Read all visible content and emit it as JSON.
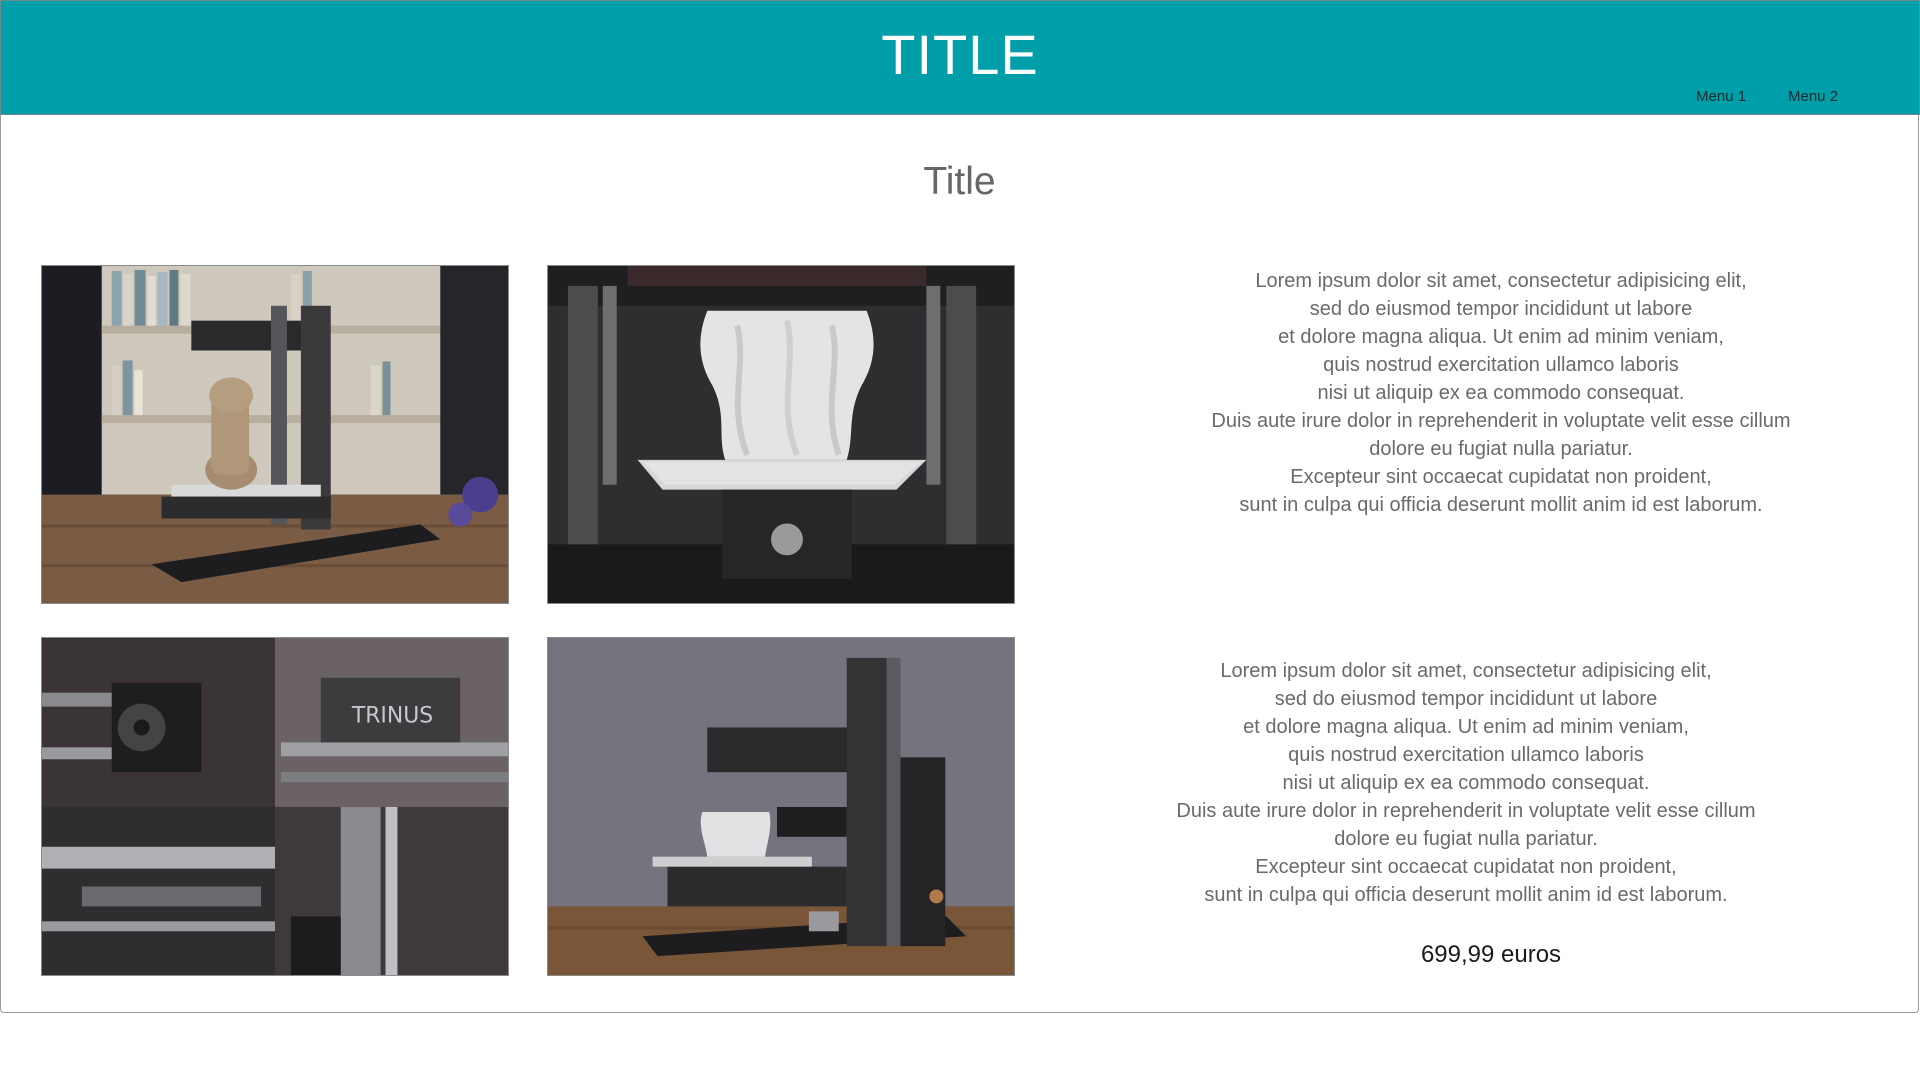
{
  "header": {
    "title": "TITLE",
    "menu": [
      "Menu 1",
      "Menu 2"
    ]
  },
  "main": {
    "title": "Title",
    "blocks": [
      {
        "lines": [
          "Lorem ipsum dolor sit amet, consectetur adipisicing elit,",
          "sed do eiusmod tempor incididunt ut labore",
          "et dolore magna aliqua. Ut enim ad minim veniam,",
          "quis nostrud exercitation ullamco laboris",
          "nisi ut aliquip ex ea commodo consequat.",
          "Duis aute irure dolor in reprehenderit in voluptate velit esse cillum",
          "dolore eu fugiat nulla pariatur.",
          "Excepteur sint occaecat cupidatat non proident,",
          "sunt in culpa qui officia deserunt mollit anim id est laborum."
        ]
      },
      {
        "lines": [
          "Lorem ipsum dolor sit amet, consectetur adipisicing elit,",
          "sed do eiusmod tempor incididunt ut labore",
          "et dolore magna aliqua. Ut enim ad minim veniam,",
          "quis nostrud exercitation ullamco laboris",
          "nisi ut aliquip ex ea commodo consequat.",
          "Duis aute irure dolor in reprehenderit in voluptate velit esse cillum",
          "dolore eu fugiat nulla pariatur.",
          "Excepteur sint occaecat cupidatat non proident,",
          "sunt in culpa qui officia deserunt mollit anim id est laborum."
        ]
      }
    ],
    "price": "699,99 euros",
    "photo_label_text": "TRINUS"
  },
  "colors": {
    "header_bg": "#009ea8",
    "text": "#6a6a6a"
  }
}
